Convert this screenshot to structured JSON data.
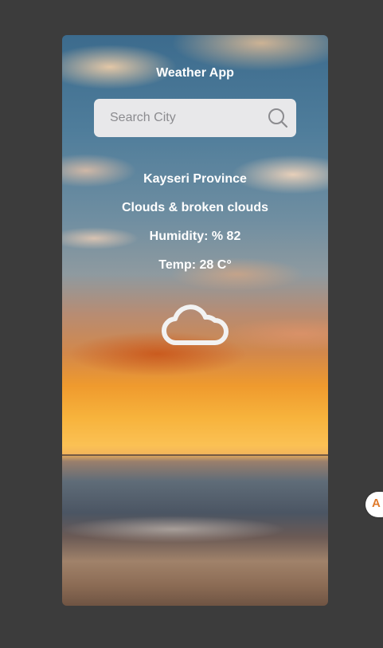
{
  "app": {
    "title": "Weather App"
  },
  "search": {
    "placeholder": "Search City",
    "value": "",
    "icon": "search-icon"
  },
  "weather": {
    "city": "Kayseri Province",
    "description": "Clouds & broken clouds",
    "humidity": "Humidity: % 82",
    "temp": "Temp: 28 C°",
    "icon": "cloud-icon"
  },
  "side_widget": {
    "icon": "translate-icon",
    "glyph": "A"
  },
  "colors": {
    "page_background": "#3c3c3c",
    "text": "#ffffff",
    "search_background": "#e8e8ea"
  }
}
